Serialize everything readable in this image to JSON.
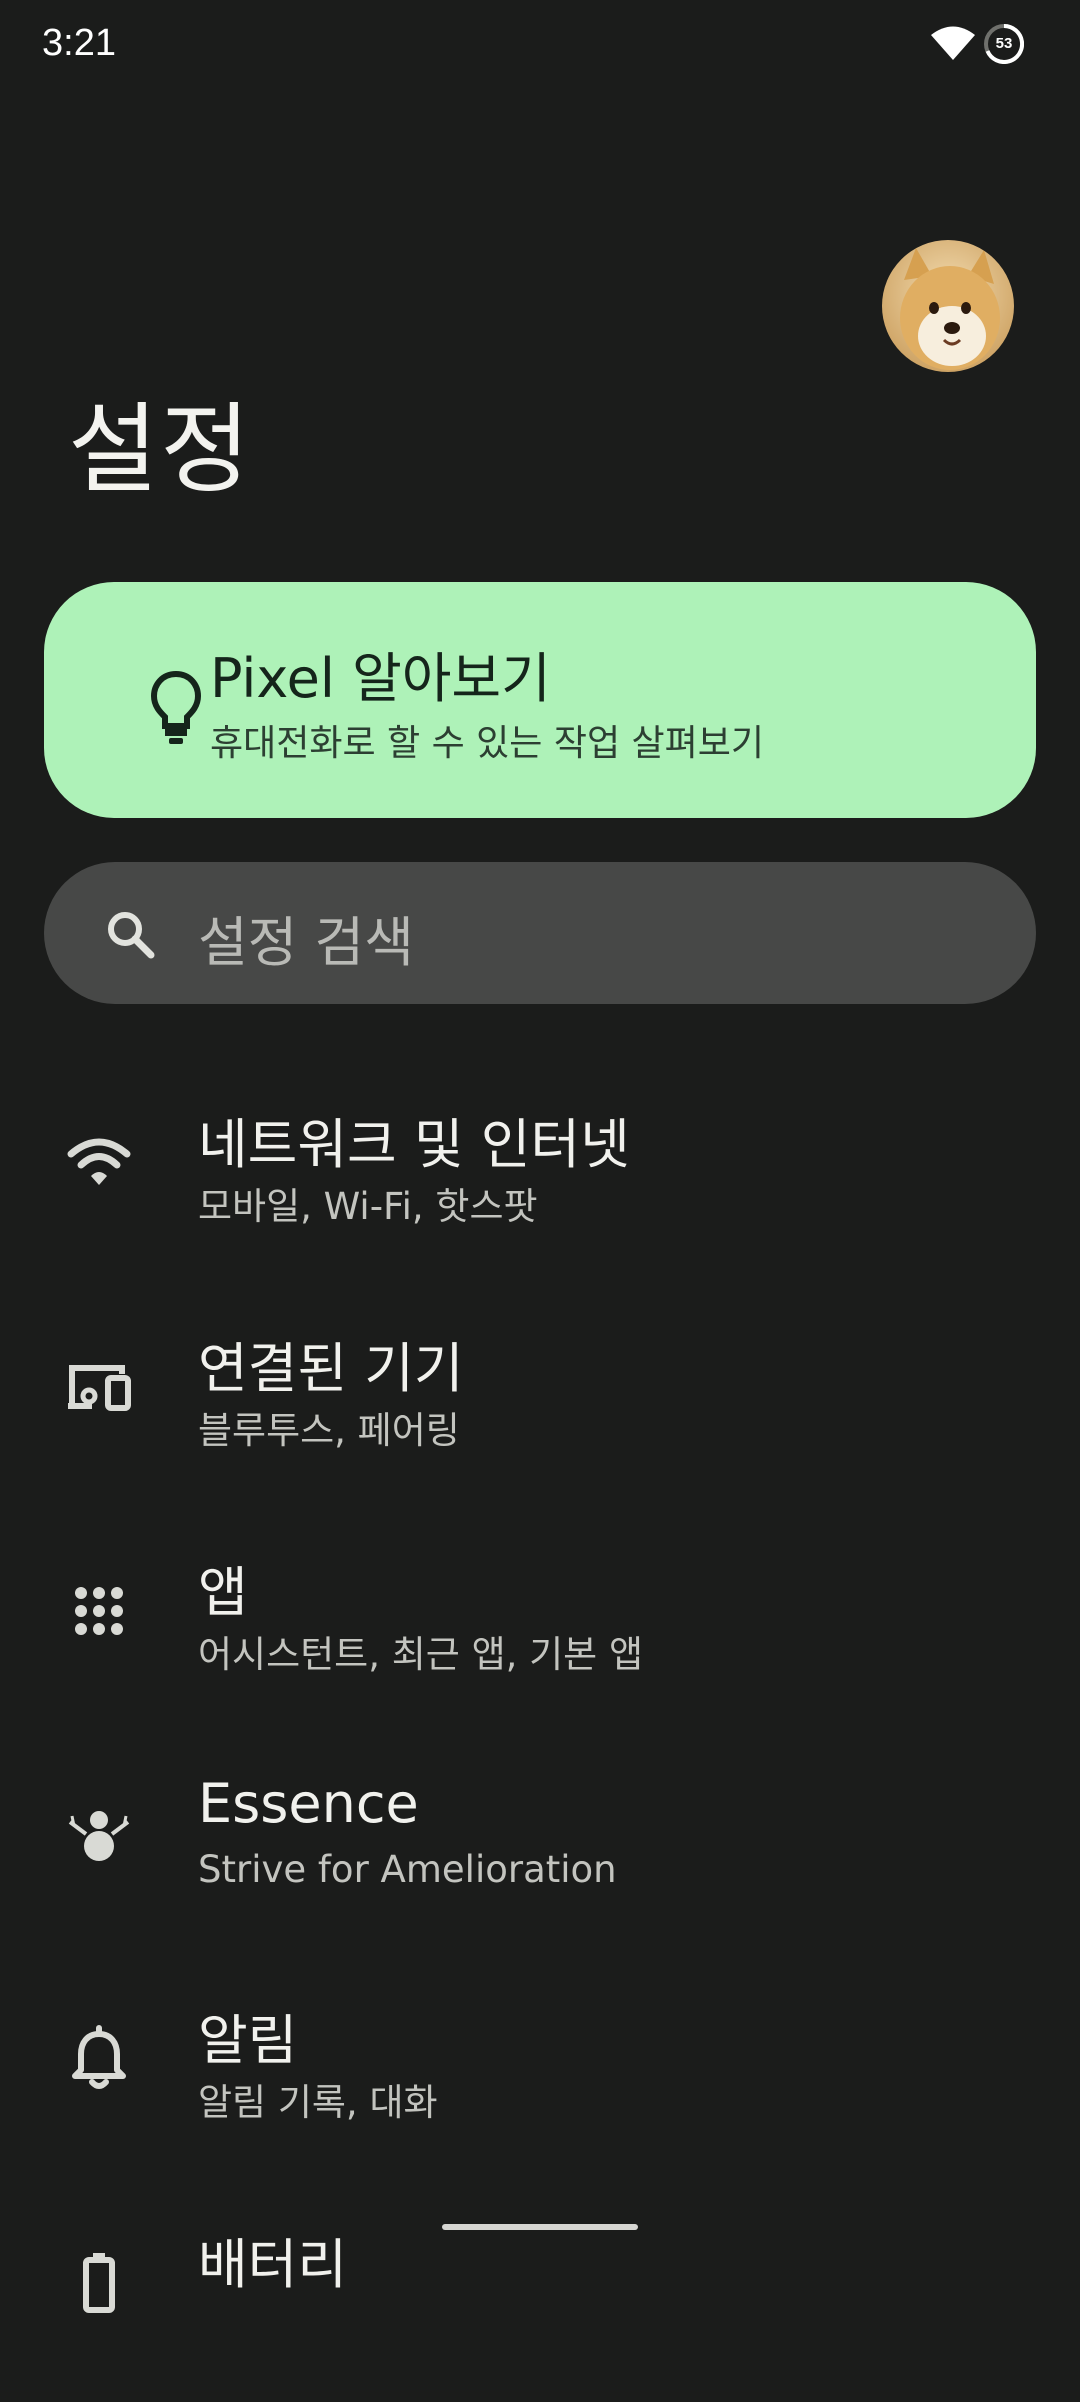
{
  "status_bar": {
    "time": "3:21",
    "battery_level": "53",
    "icons": [
      "wifi-icon",
      "battery-icon"
    ]
  },
  "header": {
    "title": "설정",
    "avatar": "profile-avatar"
  },
  "pixel_card": {
    "title": "Pixel 알아보기",
    "subtitle": "휴대전화로 할 수 있는 작업 살펴보기",
    "icon": "lightbulb-icon",
    "background": "#aef2b8"
  },
  "search": {
    "placeholder": "설정 검색",
    "icon": "search-icon"
  },
  "settings": [
    {
      "icon": "wifi-icon",
      "title": "네트워크 및 인터넷",
      "subtitle": "모바일, Wi-Fi, 핫스팟"
    },
    {
      "icon": "connected-devices-icon",
      "title": "연결된 기기",
      "subtitle": "블루투스, 페어링"
    },
    {
      "icon": "apps-grid-icon",
      "title": "앱",
      "subtitle": "어시스턴트, 최근 앱, 기본 앱"
    },
    {
      "icon": "snowman-icon",
      "title": "Essence",
      "subtitle": "Strive for Amelioration"
    },
    {
      "icon": "bell-icon",
      "title": "알림",
      "subtitle": "알림 기록, 대화"
    },
    {
      "icon": "battery-icon",
      "title": "배터리",
      "subtitle": ""
    }
  ],
  "colors": {
    "background": "#1b1c1b",
    "search_bar": "#474847",
    "accent_card": "#aef2b8",
    "icon": "#d9dad5"
  }
}
